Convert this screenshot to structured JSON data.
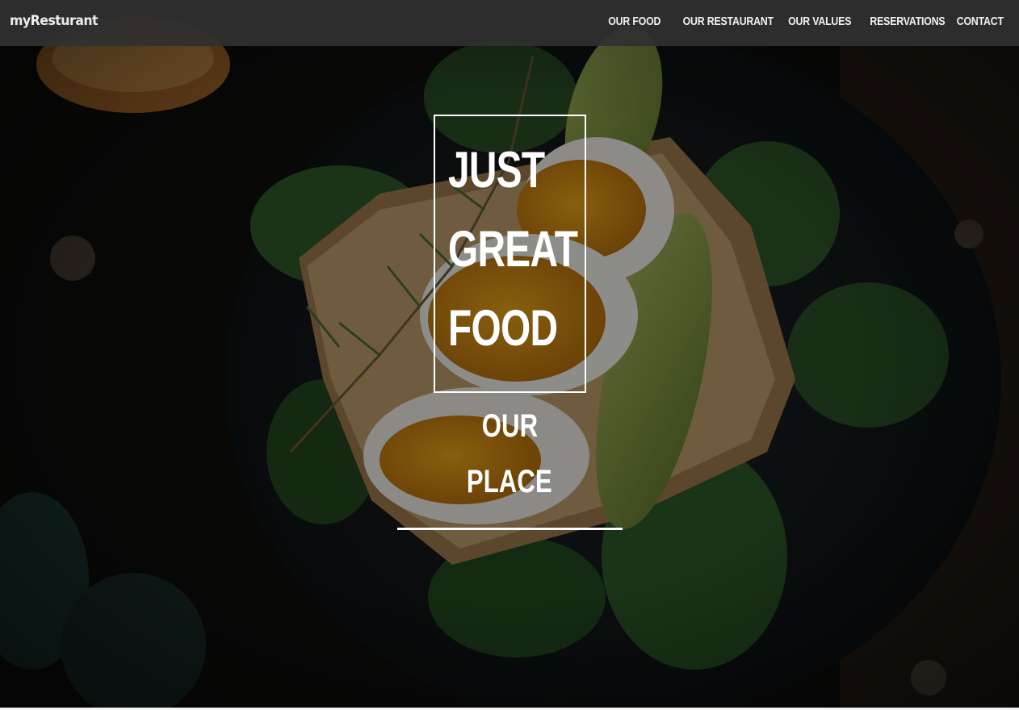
{
  "brand": {
    "name": "myResturant"
  },
  "nav": {
    "items": [
      {
        "label": "OUR FOOD"
      },
      {
        "label": "OUR RESTAURANT"
      },
      {
        "label": "OUR VALUES"
      },
      {
        "label": "RESERVATIONS"
      },
      {
        "label": "CONTACT"
      }
    ]
  },
  "hero": {
    "headline": [
      "JUST",
      "GREAT",
      "FOOD"
    ],
    "subline": [
      "OUR",
      "PLACE"
    ]
  },
  "colors": {
    "navbar": "#303030",
    "text": "#ffffff",
    "background": "#0d0f0c"
  }
}
